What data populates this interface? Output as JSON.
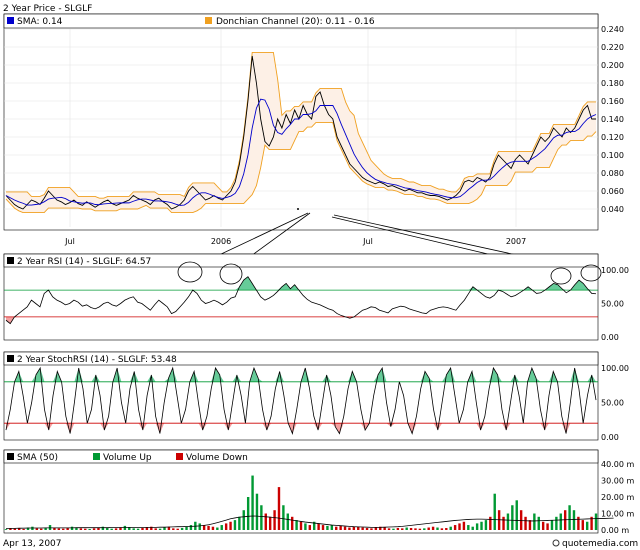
{
  "title": "2 Year Price - SLGLF",
  "footer_date": "Apr 13, 2007",
  "footer_brand": "quotemedia.com",
  "colors": {
    "price": "#000000",
    "sma": "#0000cc",
    "donchian": "#f0a020",
    "donchian_fill": "#fdf0e6",
    "overbought": "#009933",
    "oversold": "#cc0000",
    "ob_fill": "#66cc99",
    "os_fill": "#f4a0a0",
    "vol_up": "#009933",
    "vol_down": "#cc0000",
    "sma_vol": "#000000"
  },
  "chart_data": [
    {
      "type": "line",
      "name": "price",
      "legend": [
        {
          "label": "SMA: 0.14",
          "color": "#0000cc"
        },
        {
          "label": "Donchian Channel (20): 0.11 - 0.16",
          "color": "#f0a020"
        }
      ],
      "ylim": [
        0.02,
        0.24
      ],
      "yticks": [
        "0.240",
        "0.220",
        "0.200",
        "0.180",
        "0.160",
        "0.140",
        "0.120",
        "0.100",
        "0.080",
        "0.060",
        "0.040"
      ],
      "xticks": [
        "Jul",
        "2006",
        "Jul",
        "2007"
      ],
      "series": [
        {
          "name": "Price",
          "values": [
            0.055,
            0.05,
            0.045,
            0.042,
            0.04,
            0.045,
            0.05,
            0.048,
            0.045,
            0.052,
            0.06,
            0.055,
            0.05,
            0.048,
            0.045,
            0.047,
            0.05,
            0.046,
            0.044,
            0.048,
            0.045,
            0.042,
            0.045,
            0.048,
            0.05,
            0.046,
            0.044,
            0.046,
            0.048,
            0.05,
            0.055,
            0.052,
            0.05,
            0.048,
            0.045,
            0.05,
            0.052,
            0.048,
            0.045,
            0.04,
            0.042,
            0.045,
            0.05,
            0.06,
            0.065,
            0.06,
            0.055,
            0.05,
            0.052,
            0.055,
            0.052,
            0.05,
            0.055,
            0.06,
            0.07,
            0.09,
            0.12,
            0.16,
            0.21,
            0.18,
            0.14,
            0.115,
            0.11,
            0.12,
            0.14,
            0.13,
            0.145,
            0.135,
            0.15,
            0.14,
            0.155,
            0.145,
            0.14,
            0.165,
            0.17,
            0.155,
            0.145,
            0.14,
            0.12,
            0.11,
            0.1,
            0.09,
            0.085,
            0.08,
            0.075,
            0.072,
            0.07,
            0.068,
            0.07,
            0.068,
            0.065,
            0.066,
            0.064,
            0.062,
            0.06,
            0.062,
            0.06,
            0.058,
            0.058,
            0.056,
            0.055,
            0.055,
            0.054,
            0.052,
            0.05,
            0.052,
            0.055,
            0.06,
            0.07,
            0.072,
            0.07,
            0.075,
            0.073,
            0.07,
            0.075,
            0.09,
            0.1,
            0.095,
            0.09,
            0.085,
            0.095,
            0.1,
            0.095,
            0.09,
            0.1,
            0.11,
            0.12,
            0.115,
            0.12,
            0.13,
            0.125,
            0.12,
            0.13,
            0.125,
            0.13,
            0.14,
            0.15,
            0.155,
            0.14,
            0.14
          ]
        }
      ]
    },
    {
      "type": "line",
      "name": "rsi",
      "label": "2 Year  RSI (14) - SLGLF: 64.57",
      "ylim": [
        0,
        100
      ],
      "yticks": [
        "100.00",
        "50.00",
        "0.00"
      ],
      "overbought": 70,
      "oversold": 30,
      "series": [
        {
          "name": "RSI",
          "values": [
            25,
            20,
            30,
            35,
            40,
            45,
            55,
            50,
            45,
            65,
            70,
            60,
            55,
            52,
            48,
            50,
            55,
            52,
            46,
            48,
            44,
            42,
            45,
            50,
            52,
            48,
            46,
            50,
            55,
            58,
            60,
            52,
            50,
            45,
            40,
            48,
            55,
            50,
            45,
            35,
            38,
            45,
            52,
            60,
            70,
            65,
            55,
            50,
            52,
            55,
            52,
            48,
            52,
            58,
            60,
            75,
            85,
            90,
            80,
            70,
            60,
            55,
            58,
            62,
            68,
            75,
            80,
            72,
            78,
            70,
            62,
            56,
            52,
            50,
            48,
            45,
            42,
            40,
            35,
            32,
            30,
            28,
            30,
            35,
            40,
            42,
            45,
            44,
            40,
            38,
            36,
            42,
            44,
            46,
            45,
            42,
            40,
            38,
            36,
            35,
            40,
            42,
            44,
            45,
            44,
            42,
            40,
            48,
            55,
            65,
            75,
            70,
            65,
            60,
            58,
            62,
            70,
            68,
            64,
            60,
            62,
            66,
            70,
            75,
            70,
            65,
            66,
            70,
            75,
            80,
            78,
            72,
            66,
            70,
            78,
            85,
            80,
            72,
            65,
            64.57
          ]
        }
      ]
    },
    {
      "type": "line",
      "name": "stochrsi",
      "label": "2 Year  StochRSI (14) - SLGLF: 53.48",
      "ylim": [
        0,
        100
      ],
      "yticks": [
        "100.00",
        "50.00",
        "0.00"
      ],
      "overbought": 80,
      "oversold": 20,
      "series": [
        {
          "name": "StochRSI",
          "values": [
            10,
            40,
            80,
            95,
            60,
            20,
            50,
            90,
            100,
            40,
            10,
            60,
            95,
            80,
            30,
            5,
            50,
            100,
            70,
            20,
            40,
            90,
            60,
            10,
            30,
            80,
            100,
            50,
            20,
            70,
            95,
            40,
            10,
            60,
            90,
            30,
            5,
            50,
            85,
            100,
            60,
            20,
            40,
            80,
            95,
            50,
            10,
            30,
            70,
            100,
            90,
            40,
            10,
            50,
            90,
            60,
            20,
            80,
            100,
            85,
            40,
            10,
            30,
            70,
            95,
            60,
            20,
            5,
            40,
            80,
            100,
            70,
            30,
            10,
            50,
            90,
            60,
            15,
            5,
            30,
            70,
            95,
            80,
            40,
            10,
            20,
            60,
            90,
            100,
            50,
            15,
            40,
            80,
            60,
            20,
            5,
            30,
            70,
            95,
            85,
            40,
            10,
            50,
            90,
            100,
            60,
            20,
            40,
            80,
            95,
            50,
            10,
            30,
            70,
            100,
            90,
            40,
            10,
            50,
            90,
            60,
            20,
            80,
            100,
            85,
            40,
            10,
            60,
            95,
            80,
            30,
            5,
            50,
            100,
            70,
            20,
            60,
            90,
            53.48
          ]
        }
      ]
    },
    {
      "type": "bar",
      "name": "volume",
      "legend": [
        {
          "label": "SMA (50)",
          "color": "#000000"
        },
        {
          "label": "Volume Up",
          "color": "#009933"
        },
        {
          "label": "Volume Down",
          "color": "#cc0000"
        }
      ],
      "ylim": [
        0,
        40
      ],
      "yticks": [
        "40.00 m",
        "30.00 m",
        "20.00 m",
        "10.00 m",
        "0.00 m"
      ],
      "series": [
        {
          "name": "Volume",
          "values": [
            0.5,
            1,
            0.8,
            1.2,
            0.6,
            1.5,
            2,
            1,
            0.8,
            1.2,
            3,
            1.5,
            1,
            0.8,
            1.2,
            2,
            1.5,
            1,
            0.8,
            0.6,
            1,
            1.5,
            2,
            1.2,
            0.8,
            1,
            1.5,
            2.5,
            1.8,
            1,
            0.8,
            1.2,
            1.5,
            2,
            1,
            0.8,
            1.5,
            2,
            1,
            0.8,
            1.2,
            2,
            3,
            5,
            4,
            3,
            2.5,
            2,
            1.5,
            3,
            4,
            5,
            6,
            8,
            12,
            20,
            33,
            22,
            15,
            10,
            8,
            12,
            26,
            15,
            10,
            8,
            6,
            5,
            4,
            3,
            5,
            4,
            3,
            2.5,
            3,
            2,
            2.5,
            2,
            1.5,
            2,
            1.8,
            1.5,
            1.2,
            1,
            1.5,
            2,
            1.5,
            1,
            0.8,
            1.2,
            1,
            1.5,
            1.2,
            1,
            0.8,
            1,
            1.5,
            2,
            1.5,
            1,
            1.2,
            2,
            3,
            4,
            5,
            3,
            2,
            4,
            5,
            6,
            8,
            22,
            12,
            8,
            10,
            15,
            18,
            12,
            8,
            6,
            10,
            8,
            5,
            4,
            6,
            8,
            10,
            12,
            15,
            12,
            8,
            6,
            5,
            8,
            10
          ]
        },
        {
          "name": "SMA (50)",
          "values": [
            1,
            1,
            1,
            1.1,
            1.1,
            1.2,
            1.2,
            1.2,
            1.2,
            1.3,
            1.3,
            1.3,
            1.3,
            1.3,
            1.3,
            1.3,
            1.4,
            1.4,
            1.4,
            1.4,
            1.4,
            1.4,
            1.4,
            1.4,
            1.5,
            1.5,
            1.5,
            1.5,
            1.5,
            1.5,
            1.5,
            1.6,
            1.6,
            1.6,
            1.6,
            1.7,
            1.7,
            1.8,
            1.9,
            2,
            2,
            2.1,
            2.2,
            2.3,
            2.5,
            2.8,
            3.2,
            3.8,
            4.5,
            5.2,
            6,
            6.8,
            7.3,
            7.8,
            8,
            8.3,
            8.5,
            8.4,
            8.2,
            8,
            7.8,
            7.5,
            7.2,
            6.8,
            6.4,
            6,
            5.6,
            5.2,
            4.8,
            4.5,
            4.2,
            3.9,
            3.6,
            3.3,
            3,
            2.8,
            2.6,
            2.4,
            2.2,
            2,
            1.9,
            1.8,
            1.7,
            1.6,
            1.6,
            1.6,
            1.7,
            1.8,
            1.9,
            2,
            2.2,
            2.5,
            2.8,
            3.1,
            3.4,
            3.7,
            4,
            4.3,
            4.6,
            4.9,
            5.2,
            5.5,
            5.8,
            6,
            6.2,
            6.4,
            6.5,
            6.6,
            6.6,
            6.5,
            6.4,
            6.3,
            6.2,
            6.1,
            6,
            5.9,
            5.8,
            5.7,
            5.6,
            5.5,
            5.5,
            5.6,
            5.7,
            5.8,
            5.9,
            6,
            6.1,
            6.2,
            6.3,
            6.4,
            6.5,
            6.6,
            6.7,
            6.8,
            6.9,
            7,
            7,
            7.1,
            7.2
          ]
        }
      ]
    }
  ]
}
